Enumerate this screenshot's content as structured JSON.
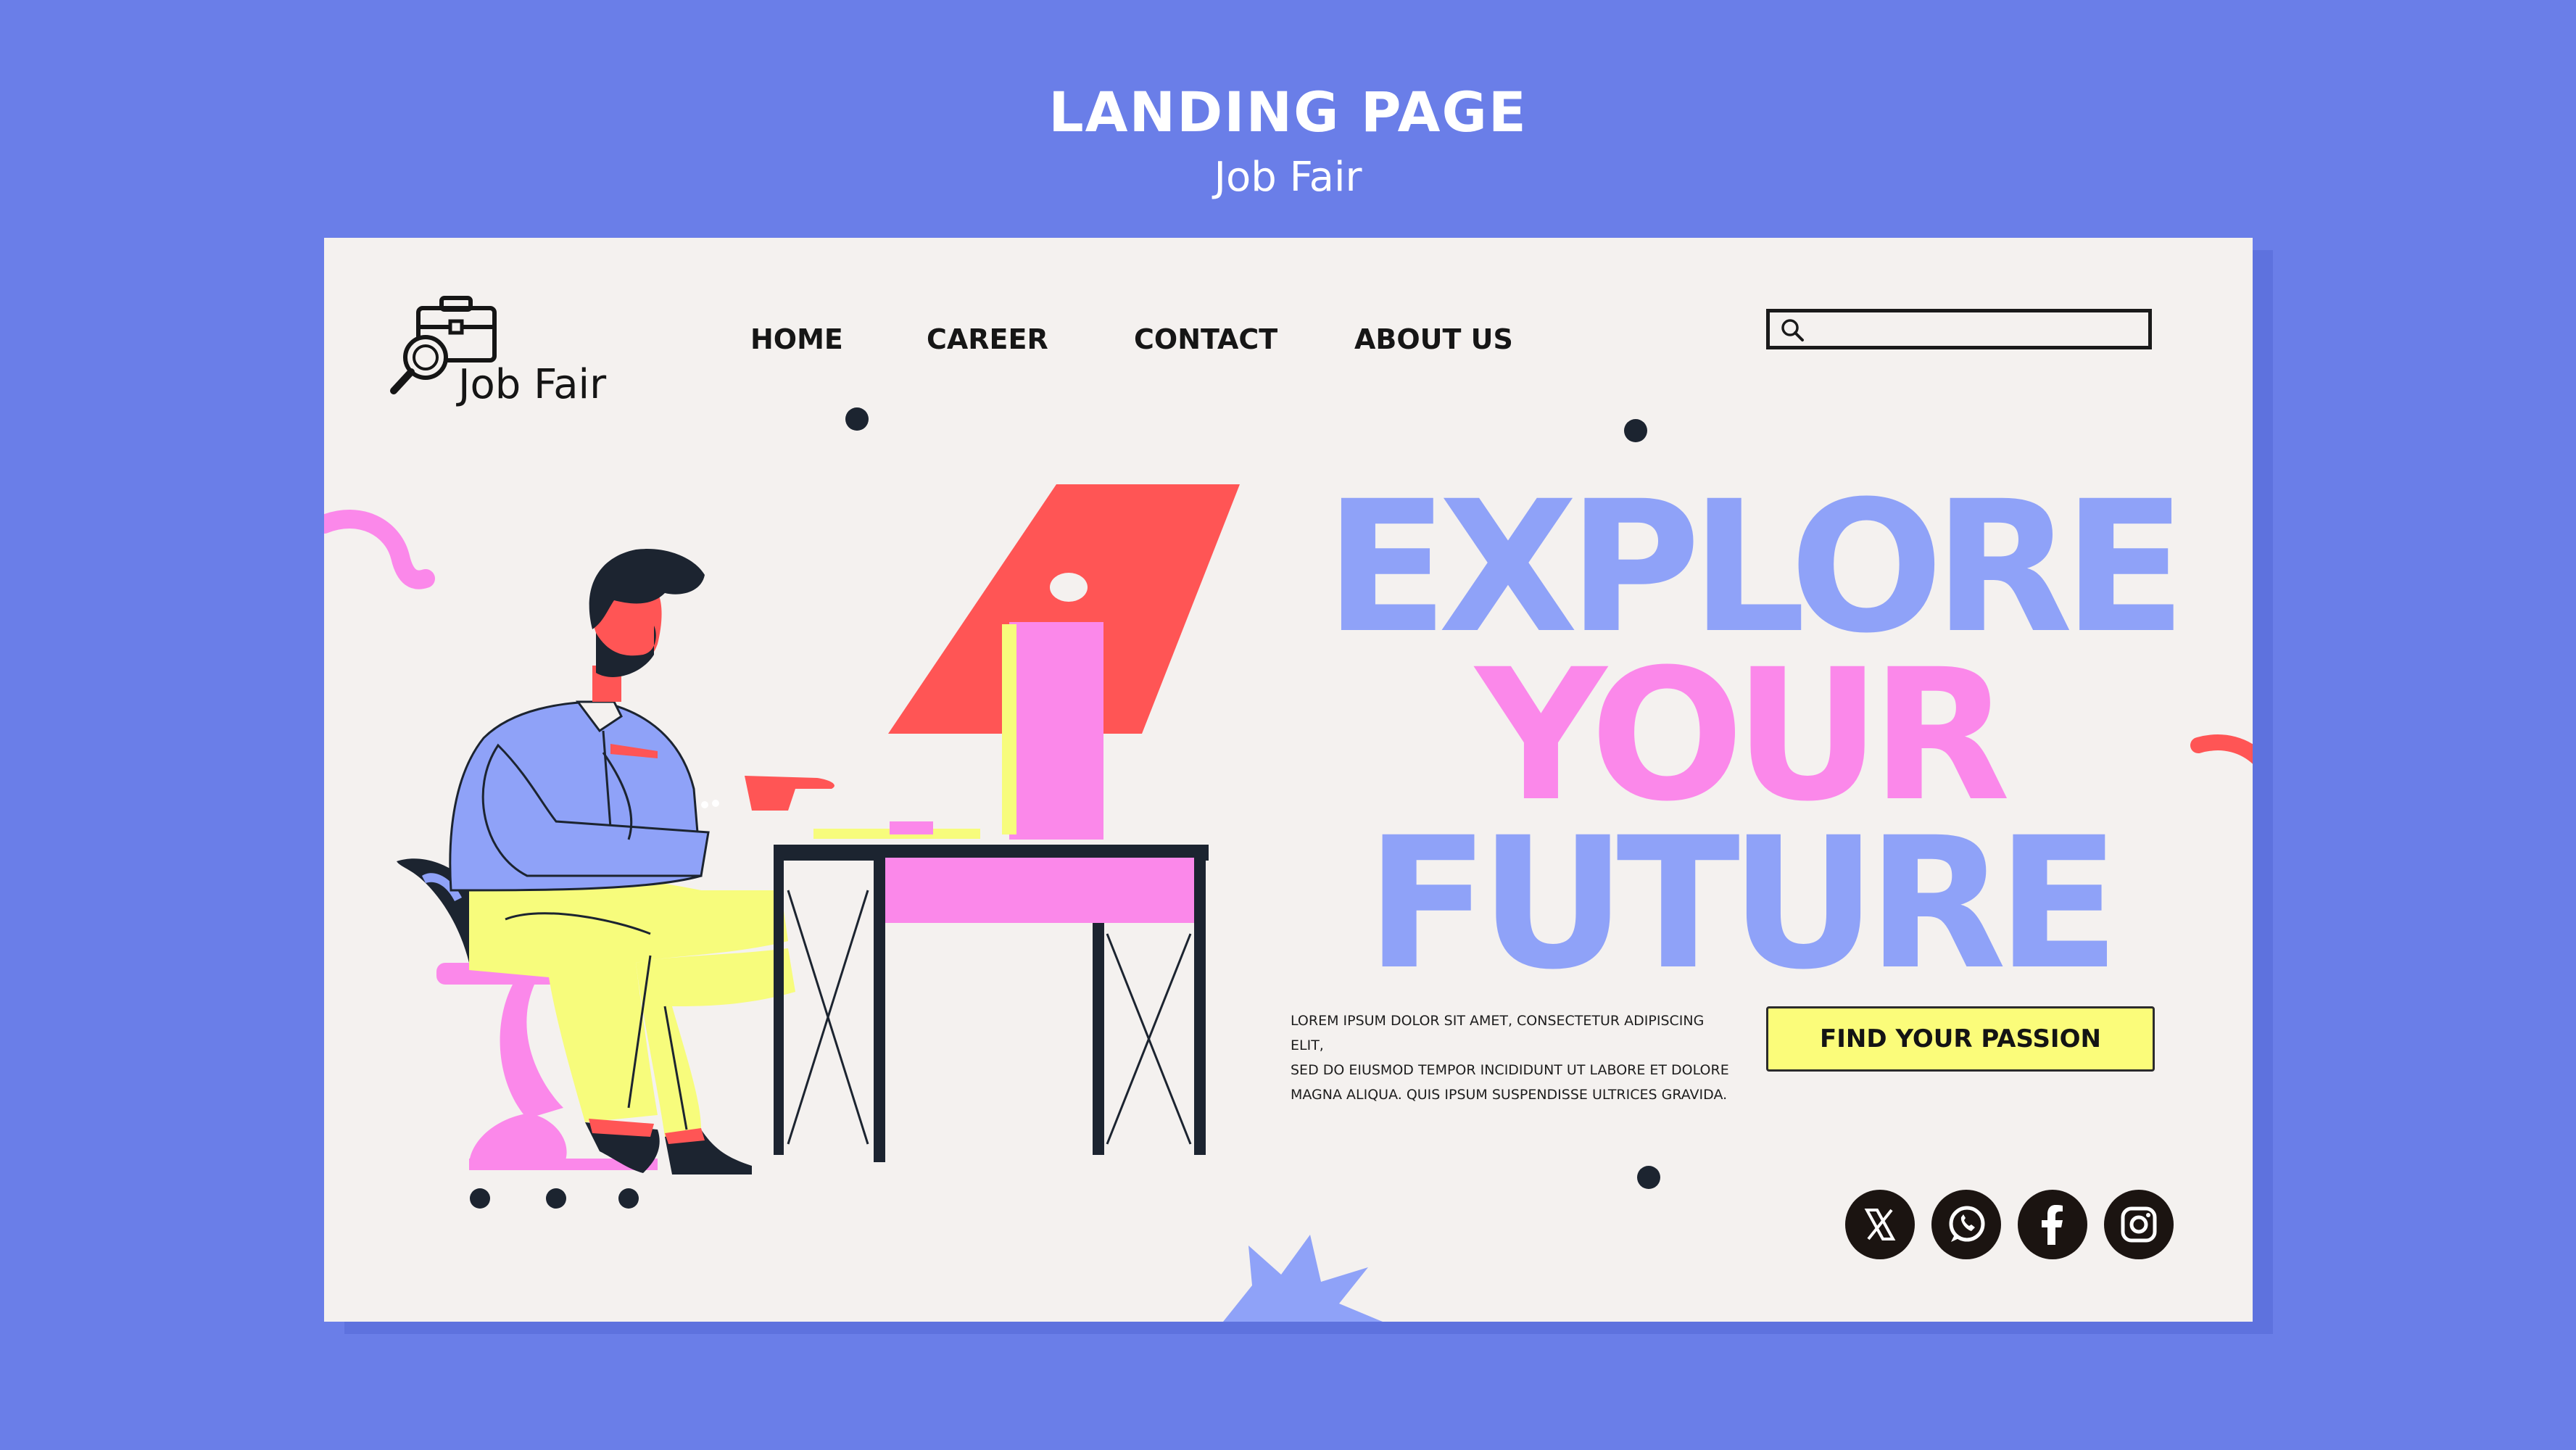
{
  "header": {
    "title": "LANDING PAGE",
    "subtitle": "Job Fair"
  },
  "brand": {
    "name": "Job Fair",
    "icon": "briefcase-magnifier-icon"
  },
  "nav": {
    "items": [
      {
        "label": "HOME"
      },
      {
        "label": "CAREER"
      },
      {
        "label": "CONTACT"
      },
      {
        "label": "ABOUT US"
      }
    ]
  },
  "search": {
    "icon": "search-icon",
    "value": "",
    "placeholder": ""
  },
  "hero": {
    "line1": "EXPLORE",
    "line2": "YOUR",
    "line3": "FUTURE",
    "body_line1": "LOREM IPSUM DOLOR SIT AMET, CONSECTETUR ADIPISCING ELIT,",
    "body_line2": "SED DO EIUSMOD TEMPOR INCIDIDUNT UT LABORE ET DOLORE",
    "body_line3": "MAGNA ALIQUA. QUIS IPSUM SUSPENDISSE ULTRICES GRAVIDA.",
    "cta_label": "FIND YOUR PASSION"
  },
  "social": {
    "icons": [
      "x-icon",
      "whatsapp-icon",
      "facebook-icon",
      "instagram-icon"
    ]
  },
  "colors": {
    "background": "#6a7ee8",
    "card": "#f4f1ef",
    "accent_blue": "#8fa2f8",
    "accent_pink": "#fb88ea",
    "accent_yellow": "#fbfc7a",
    "accent_red": "#ff5555",
    "dark": "#1b1411"
  }
}
